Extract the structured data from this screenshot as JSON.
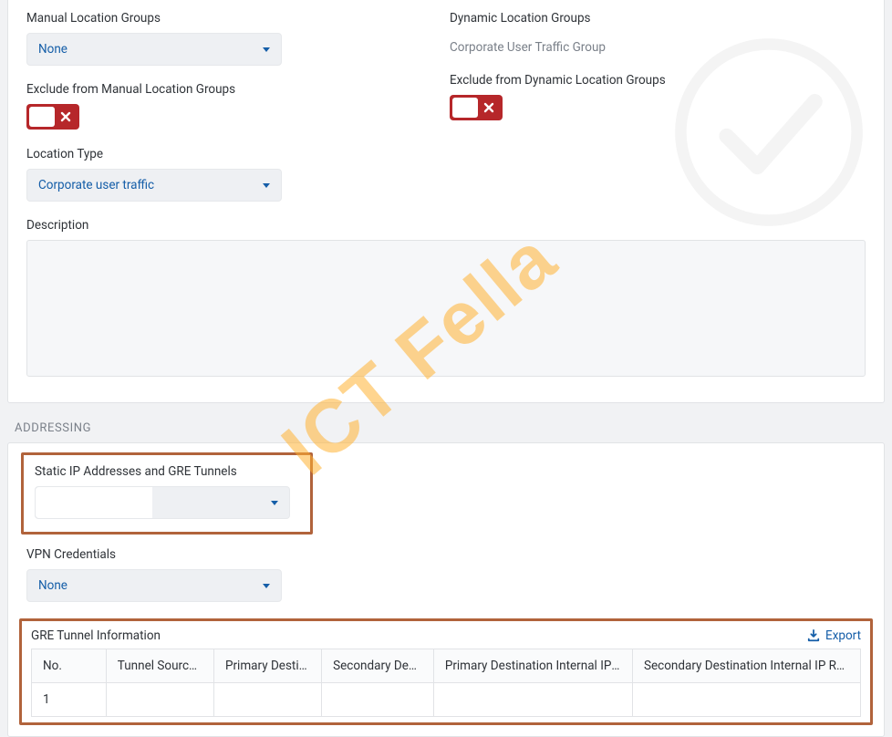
{
  "watermark": "ICT Fella",
  "top_card": {
    "left": {
      "manual_groups_label": "Manual Location Groups",
      "manual_groups_value": "None",
      "exclude_manual_label": "Exclude from Manual Location Groups",
      "location_type_label": "Location Type",
      "location_type_value": "Corporate user traffic",
      "description_label": "Description"
    },
    "right": {
      "dynamic_groups_label": "Dynamic Location Groups",
      "dynamic_groups_value": "Corporate User Traffic Group",
      "exclude_dynamic_label": "Exclude from Dynamic Location Groups"
    }
  },
  "addressing": {
    "heading": "ADDRESSING",
    "static_ip_label": "Static IP Addresses and GRE Tunnels",
    "vpn_label": "VPN Credentials",
    "vpn_value": "None",
    "gre_table": {
      "title": "GRE Tunnel Information",
      "export_label": "Export",
      "columns": [
        "No.",
        "Tunnel Source IP",
        "Primary Destination",
        "Secondary Destination",
        "Primary Destination Internal IP Range",
        "Secondary Destination Internal IP Range"
      ],
      "rows": [
        {
          "no": "1",
          "src": "",
          "pdst": "",
          "sdst": "",
          "pint": "",
          "sint": ""
        }
      ]
    }
  }
}
